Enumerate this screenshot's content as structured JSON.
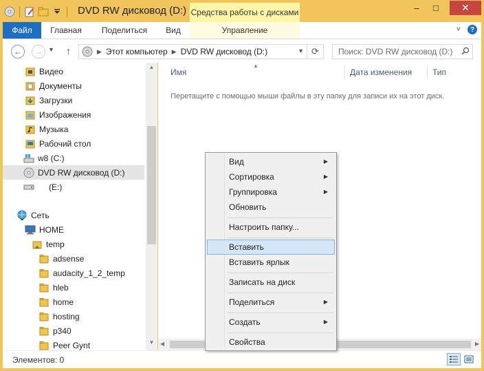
{
  "window": {
    "title": "DVD RW дисковод (D:)",
    "context_tab_group": "Средства работы с дисками",
    "minimize": "–",
    "maximize": "□",
    "close": "✕"
  },
  "ribbon": {
    "tabs": [
      {
        "label": "Файл"
      },
      {
        "label": "Главная"
      },
      {
        "label": "Поделиться"
      },
      {
        "label": "Вид"
      },
      {
        "label": "Управление"
      }
    ],
    "expand": "˅",
    "help": "?"
  },
  "address": {
    "crumbs": [
      "Этот компьютер",
      "DVD RW дисковод (D:)"
    ],
    "search_placeholder": "Поиск: DVD RW дисковод (D:)"
  },
  "nav_pane": {
    "items": [
      {
        "label": "Видео",
        "icon": "video-folder-icon"
      },
      {
        "label": "Документы",
        "icon": "documents-folder-icon"
      },
      {
        "label": "Загрузки",
        "icon": "downloads-folder-icon"
      },
      {
        "label": "Изображения",
        "icon": "pictures-folder-icon"
      },
      {
        "label": "Музыка",
        "icon": "music-folder-icon"
      },
      {
        "label": "Рабочий стол",
        "icon": "desktop-folder-icon"
      },
      {
        "label": "w8 (C:)",
        "icon": "system-drive-icon"
      },
      {
        "label": "DVD RW дисковод (D:)",
        "icon": "dvd-drive-icon",
        "selected": true
      },
      {
        "label": "(E:)",
        "icon": "removable-drive-icon"
      },
      {
        "label": "Сеть",
        "icon": "network-icon"
      },
      {
        "label": "HOME",
        "icon": "computer-icon"
      },
      {
        "label": "temp",
        "icon": "shared-folder-icon"
      },
      {
        "label": "adsense",
        "icon": "folder-icon"
      },
      {
        "label": "audacity_1_2_temp",
        "icon": "folder-icon"
      },
      {
        "label": "hleb",
        "icon": "folder-icon"
      },
      {
        "label": "home",
        "icon": "folder-icon"
      },
      {
        "label": "hosting",
        "icon": "folder-icon"
      },
      {
        "label": "p340",
        "icon": "folder-icon"
      },
      {
        "label": "Peer Gynt",
        "icon": "folder-icon"
      }
    ]
  },
  "content": {
    "columns": [
      "Имя",
      "Дата изменения",
      "Тип"
    ],
    "empty_message": "Перетащите с помощью мыши файлы в эту папку для записи их на этот диск."
  },
  "status": {
    "items_text": "Элементов: 0"
  },
  "context_menu": {
    "items": [
      {
        "label": "Вид",
        "submenu": true
      },
      {
        "label": "Сортировка",
        "submenu": true
      },
      {
        "label": "Группировка",
        "submenu": true
      },
      {
        "label": "Обновить",
        "submenu": false
      },
      {
        "label": "Настроить папку...",
        "submenu": false
      },
      {
        "label": "Вставить",
        "submenu": false,
        "highlighted": true
      },
      {
        "label": "Вставить ярлык",
        "submenu": false
      },
      {
        "label": "Записать на диск",
        "submenu": false
      },
      {
        "label": "Поделиться",
        "submenu": true
      },
      {
        "label": "Создать",
        "submenu": true
      },
      {
        "label": "Свойства",
        "submenu": false
      }
    ]
  },
  "colors": {
    "title_bar": "#f2c55c",
    "file_tab": "#1e6fc1",
    "context_tab": "#fff6a8",
    "close_button": "#c7463e",
    "menu_highlight": "#d5e6f7"
  }
}
